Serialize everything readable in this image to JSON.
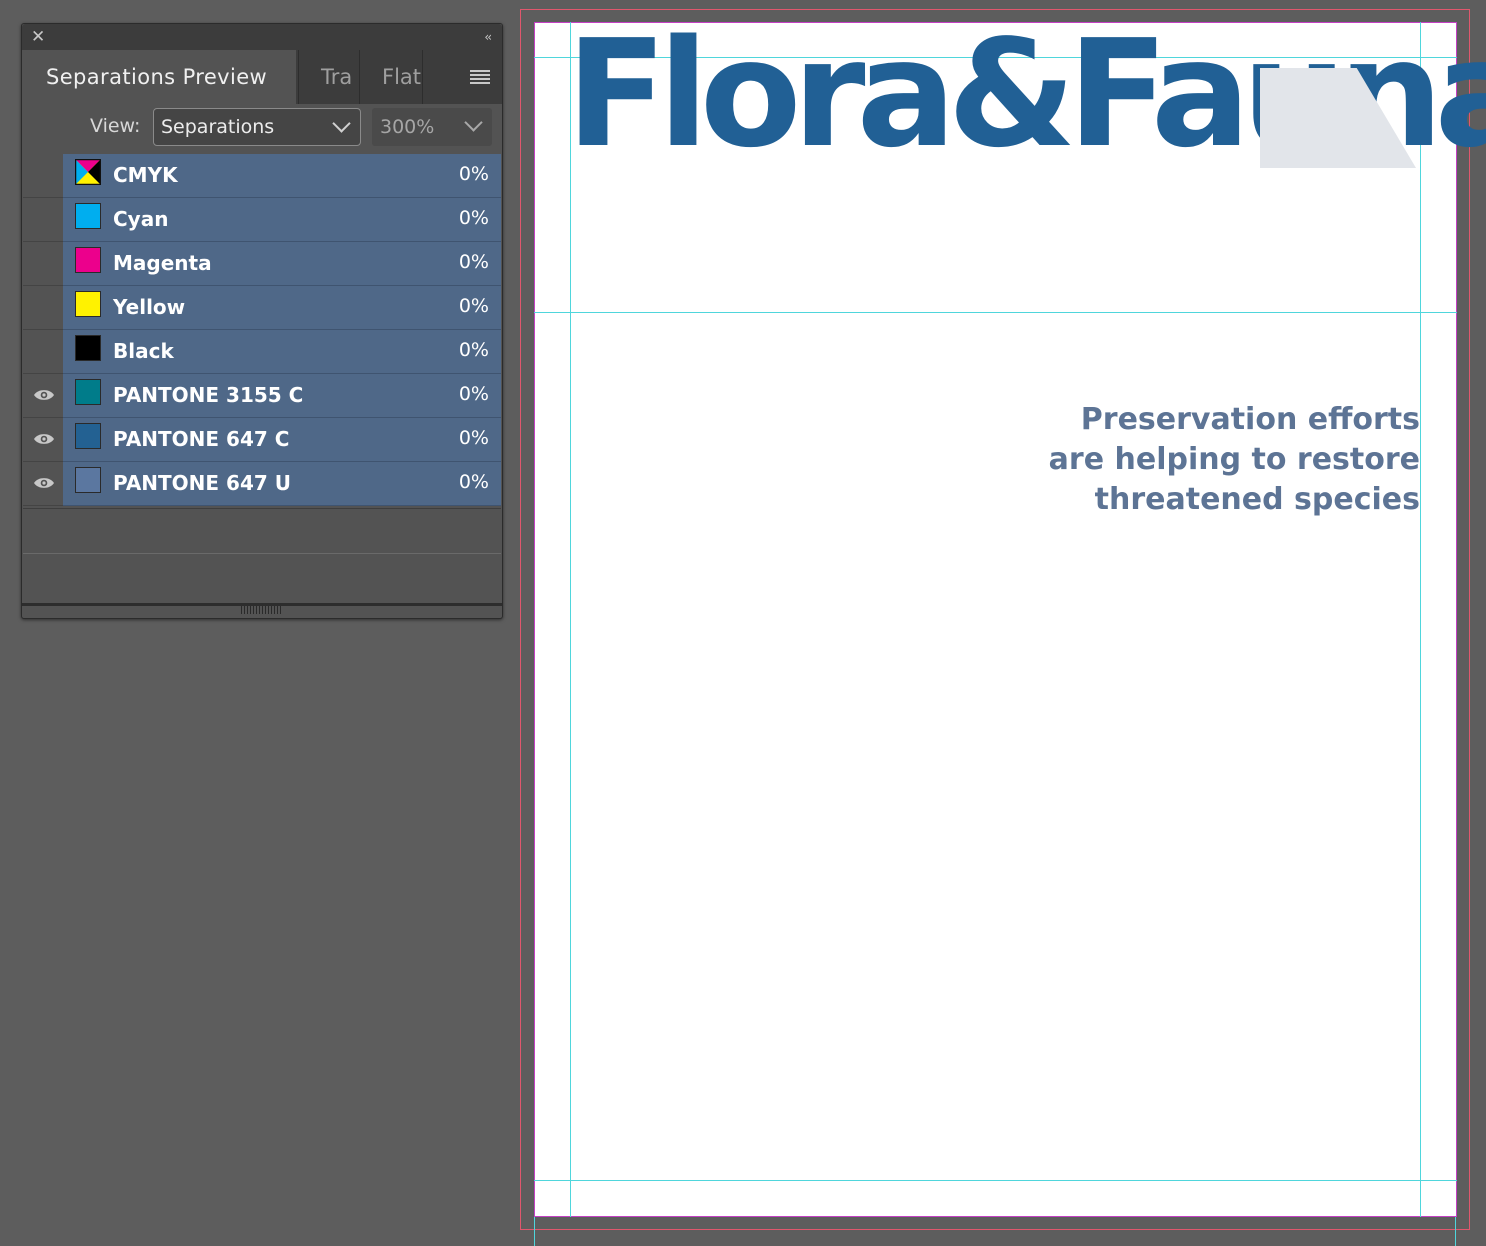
{
  "panel": {
    "tabs": [
      {
        "label": "Separations Preview",
        "active": true
      },
      {
        "label": "Tra",
        "active": false
      },
      {
        "label": "Flat",
        "active": false
      }
    ],
    "view_label": "View:",
    "view_value": "Separations",
    "zoom_value": "300%",
    "separations": [
      {
        "name": "CMYK",
        "pct": "0%",
        "color": "cmyk",
        "visible": false
      },
      {
        "name": "Cyan",
        "pct": "0%",
        "color": "#00aeef",
        "visible": false
      },
      {
        "name": "Magenta",
        "pct": "0%",
        "color": "#ec008c",
        "visible": false
      },
      {
        "name": "Yellow",
        "pct": "0%",
        "color": "#fff200",
        "visible": false
      },
      {
        "name": "Black",
        "pct": "0%",
        "color": "#000000",
        "visible": false
      },
      {
        "name": "PANTONE 3155 C",
        "pct": "0%",
        "color": "#007c8a",
        "visible": true
      },
      {
        "name": "PANTONE 647 C",
        "pct": "0%",
        "color": "#236192",
        "visible": true
      },
      {
        "name": "PANTONE 647 U",
        "pct": "0%",
        "color": "#5b77a0",
        "visible": true
      }
    ]
  },
  "document": {
    "headline": "Flora&Fauna",
    "subhead": [
      "Preservation efforts",
      "are helping to restore",
      "threatened species"
    ],
    "colors": {
      "headline": "#216095",
      "subhead": "#5d7495",
      "guide": "#4fd6dc",
      "bleed": "#e0576d",
      "margin": "#c440c4"
    }
  }
}
